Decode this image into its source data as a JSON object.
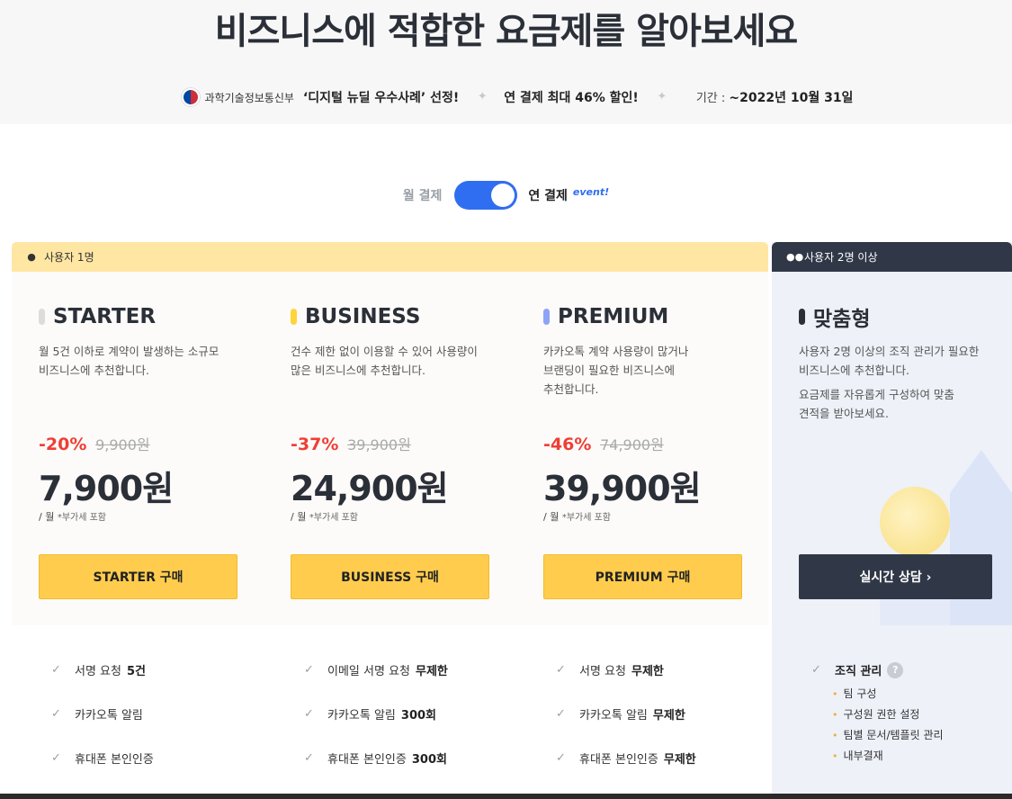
{
  "hero": {
    "title": "비즈니스에 적합한 요금제를 알아보세요",
    "ministry": "과학기술정보통신부",
    "award": "‘디지털 뉴딜 우수사례’ 선정!",
    "promo": "연 결제 최대 46% 할인!",
    "period_label": "기간 :",
    "period_value": "~2022년 10월 31일"
  },
  "billing": {
    "monthly": "월 결제",
    "annual": "연 결제",
    "event": "event!",
    "annual_selected": true,
    "toggle_color": "#2f6ef0"
  },
  "groups": {
    "single": "사용자 1명",
    "multi": "사용자 2명 이상"
  },
  "plans": [
    {
      "name": "STARTER",
      "bar_color": "#dcdcdc",
      "desc": [
        "월 5건 이하로 계약이 발생하는 소규모",
        "비즈니스에 추천합니다."
      ],
      "discount": "-20%",
      "original": "9,900원",
      "price": "7,900원",
      "unit": "/ 월",
      "vat": "*부가세 포함",
      "button": "STARTER 구매",
      "features": [
        {
          "label": "서명 요청",
          "value": "5건"
        },
        {
          "label": "카카오톡 알림",
          "value": ""
        },
        {
          "label": "휴대폰 본인인증",
          "value": ""
        }
      ]
    },
    {
      "name": "BUSINESS",
      "bar_color": "#ffd43b",
      "desc": [
        "건수 제한 없이 이용할 수 있어 사용량이",
        "많은 비즈니스에 추천합니다."
      ],
      "discount": "-37%",
      "original": "39,900원",
      "price": "24,900원",
      "unit": "/ 월",
      "vat": "*부가세 포함",
      "button": "BUSINESS 구매",
      "features": [
        {
          "label": "이메일 서명 요청",
          "value": "무제한"
        },
        {
          "label": "카카오톡 알림",
          "value": "300회"
        },
        {
          "label": "휴대폰 본인인증",
          "value": "300회"
        }
      ]
    },
    {
      "name": "PREMIUM",
      "bar_color": "#8ea3f7",
      "desc": [
        "카카오톡 계약 사용량이 많거나",
        "브랜딩이 필요한 비즈니스에",
        "추천합니다."
      ],
      "discount": "-46%",
      "original": "74,900원",
      "price": "39,900원",
      "unit": "/ 월",
      "vat": "*부가세 포함",
      "button": "PREMIUM 구매",
      "features": [
        {
          "label": "서명 요청",
          "value": "무제한"
        },
        {
          "label": "카카오톡 알림",
          "value": "무제한"
        },
        {
          "label": "휴대폰 본인인증",
          "value": "무제한"
        }
      ]
    }
  ],
  "custom": {
    "name": "맞춤형",
    "bar_color": "#2b2f38",
    "desc": [
      "사용자 2명 이상의 조직 관리가 필요한",
      "비즈니스에 추천합니다."
    ],
    "desc2": [
      "요금제를 자유롭게 구성하여 맞춤",
      "견적을 받아보세요."
    ],
    "button": "실시간 상담 ›",
    "feature_title": "조직 관리",
    "help": "?",
    "sub_features": [
      "팀 구성",
      "구성원 권한 설정",
      "팀별 문서/템플릿 관리",
      "내부결재"
    ]
  }
}
